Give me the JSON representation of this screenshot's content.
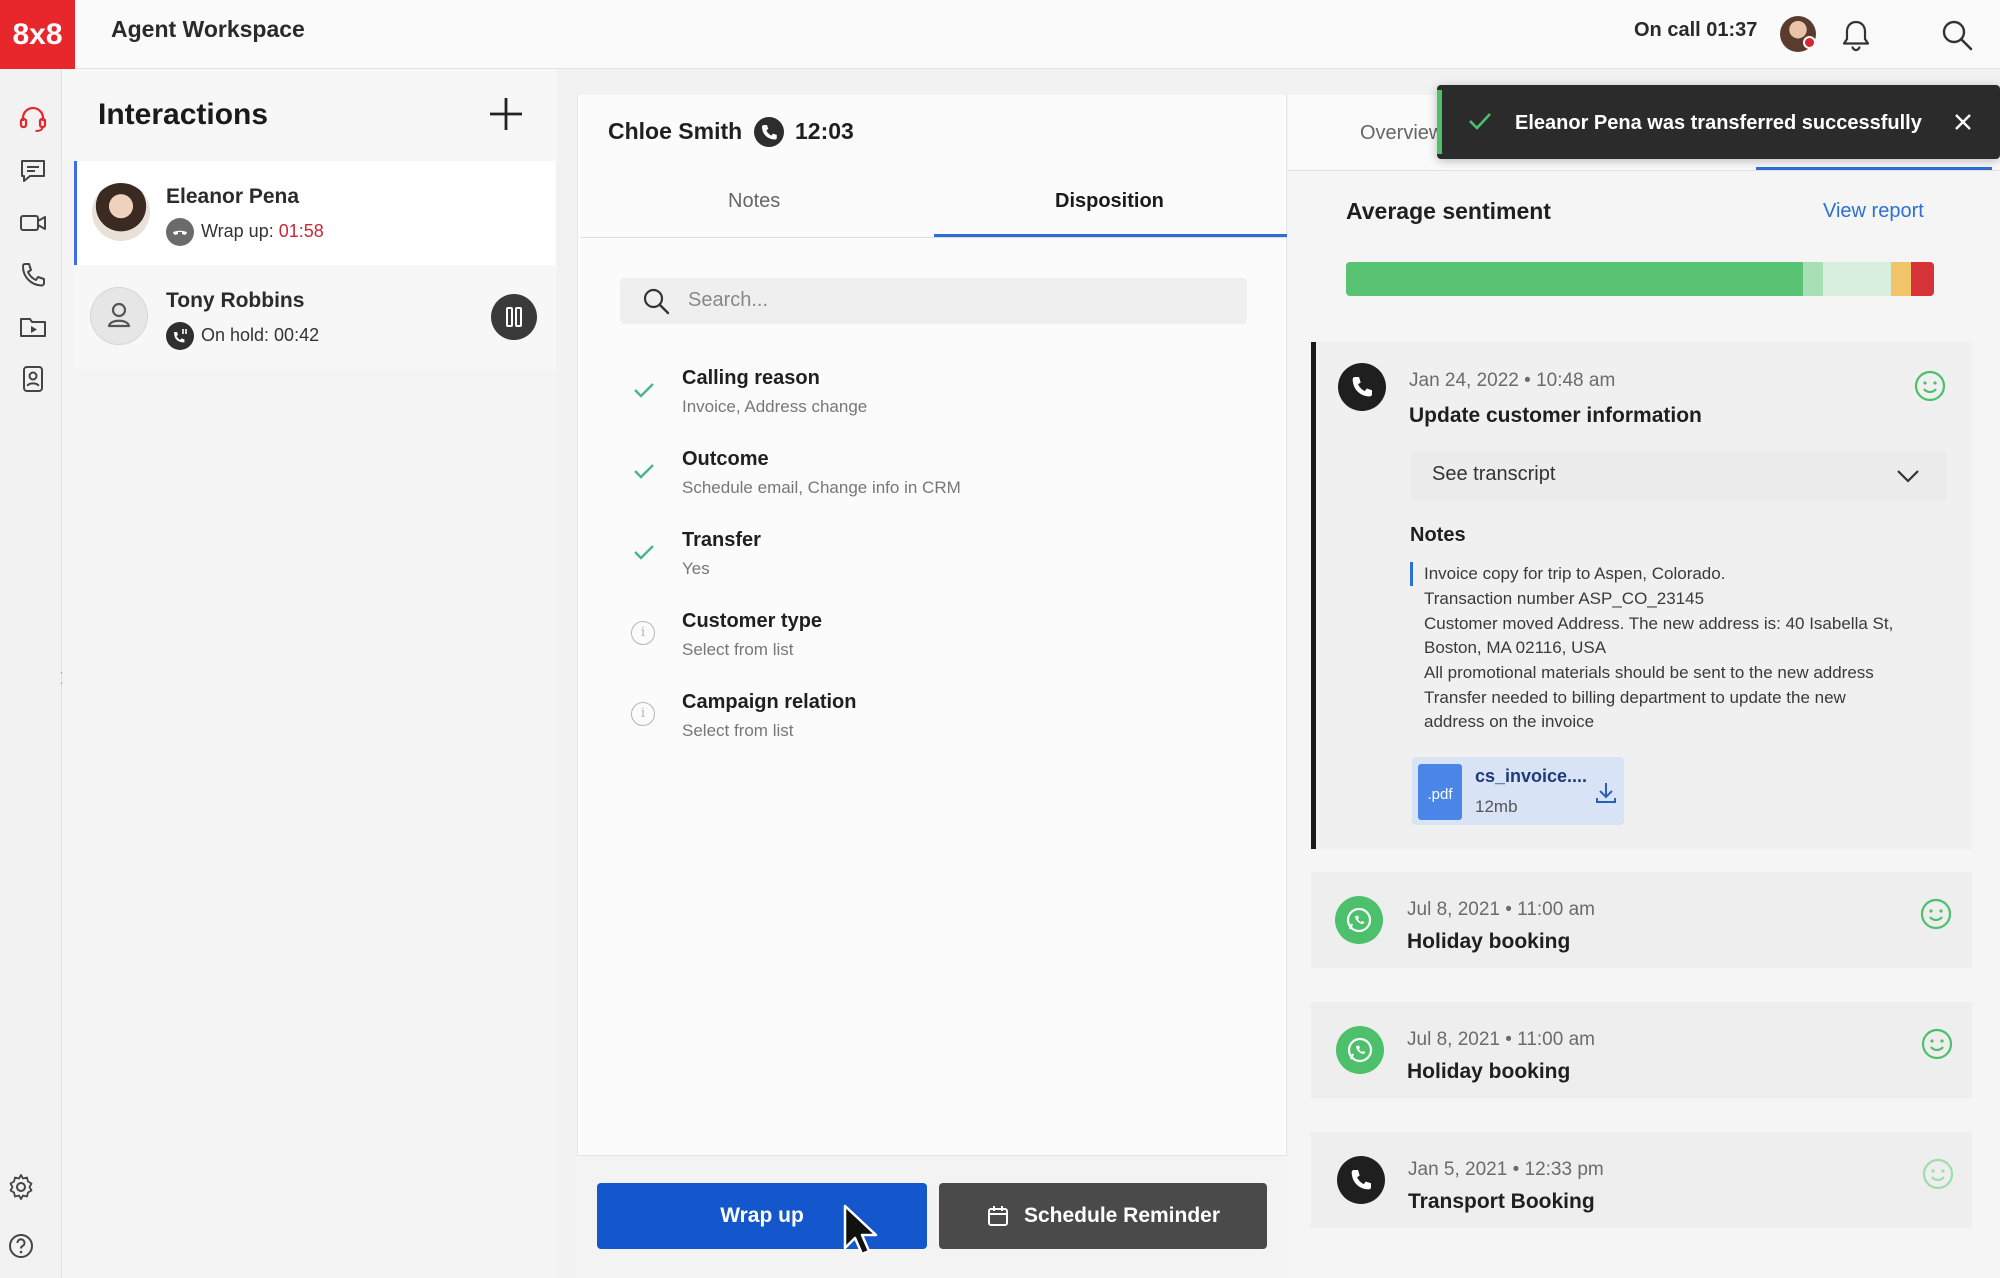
{
  "app": {
    "logo": "8x8",
    "title": "Agent Workspace"
  },
  "header": {
    "status": "On call 01:37",
    "icons": [
      "notification-bell-icon",
      "search-icon"
    ]
  },
  "rail": {
    "icons": [
      "headset-icon",
      "chat-icon",
      "video-icon",
      "phone-icon",
      "media-folder-icon",
      "contacts-icon",
      "settings-icon",
      "help-icon"
    ]
  },
  "interactions": {
    "title": "Interactions",
    "items": [
      {
        "name": "Eleanor Pena",
        "status_label": "Wrap up: ",
        "status_time": "01:58"
      },
      {
        "name": "Tony Robbins",
        "status_label": "On hold: 00:42"
      }
    ]
  },
  "call": {
    "name": "Chloe Smith",
    "duration": "12:03"
  },
  "tabs": {
    "notes": "Notes",
    "disposition": "Disposition"
  },
  "search": {
    "placeholder": "Search..."
  },
  "disposition": [
    {
      "title": "Calling reason",
      "value": "Invoice, Address change",
      "done": true
    },
    {
      "title": "Outcome",
      "value": "Schedule email, Change info in CRM",
      "done": true
    },
    {
      "title": "Transfer",
      "value": "Yes",
      "done": true
    },
    {
      "title": "Customer type",
      "value": "Select from list",
      "done": false
    },
    {
      "title": "Campaign relation",
      "value": "Select from list",
      "done": false
    }
  ],
  "actions": {
    "wrap_up": "Wrap up",
    "schedule_reminder": "Schedule Reminder"
  },
  "right": {
    "tab_overview": "Overview",
    "sentiment_title": "Average sentiment",
    "view_report": "View report",
    "sentiment_colors": [
      "#57c373",
      "#a8dfb4",
      "#d7efdc",
      "#f2c46a",
      "#d63338"
    ],
    "history": [
      {
        "channel": "phone",
        "date": "Jan 24, 2022 • 10:48 am",
        "title": "Update customer information",
        "transcript_label": "See transcript",
        "notes_title": "Notes",
        "notes": [
          "Invoice copy for trip to Aspen, Colorado.",
          "Transaction number ASP_CO_23145",
          "Customer moved Address. The new address is: 40 Isabella St,",
          "Boston, MA 02116, USA",
          "All promotional materials should be sent to the new address",
          "Transfer needed to billing department to update the new",
          "address on the invoice"
        ],
        "file": {
          "type": ".pdf",
          "name": "cs_invoice....",
          "size": "12mb"
        }
      },
      {
        "channel": "whatsapp",
        "date": "Jul 8, 2021 • 11:00 am",
        "title": "Holiday booking"
      },
      {
        "channel": "whatsapp",
        "date": "Jul 8, 2021 • 11:00 am",
        "title": "Holiday booking"
      },
      {
        "channel": "phone",
        "date": "Jan 5, 2021 • 12:33 pm",
        "title": "Transport Booking"
      }
    ]
  },
  "toast": {
    "message": "Eleanor Pena was transferred successfully"
  },
  "colors": {
    "brand": "#e8272c",
    "primary": "#1456cc",
    "accent": "#2c6fd6",
    "success": "#4cc06a"
  }
}
